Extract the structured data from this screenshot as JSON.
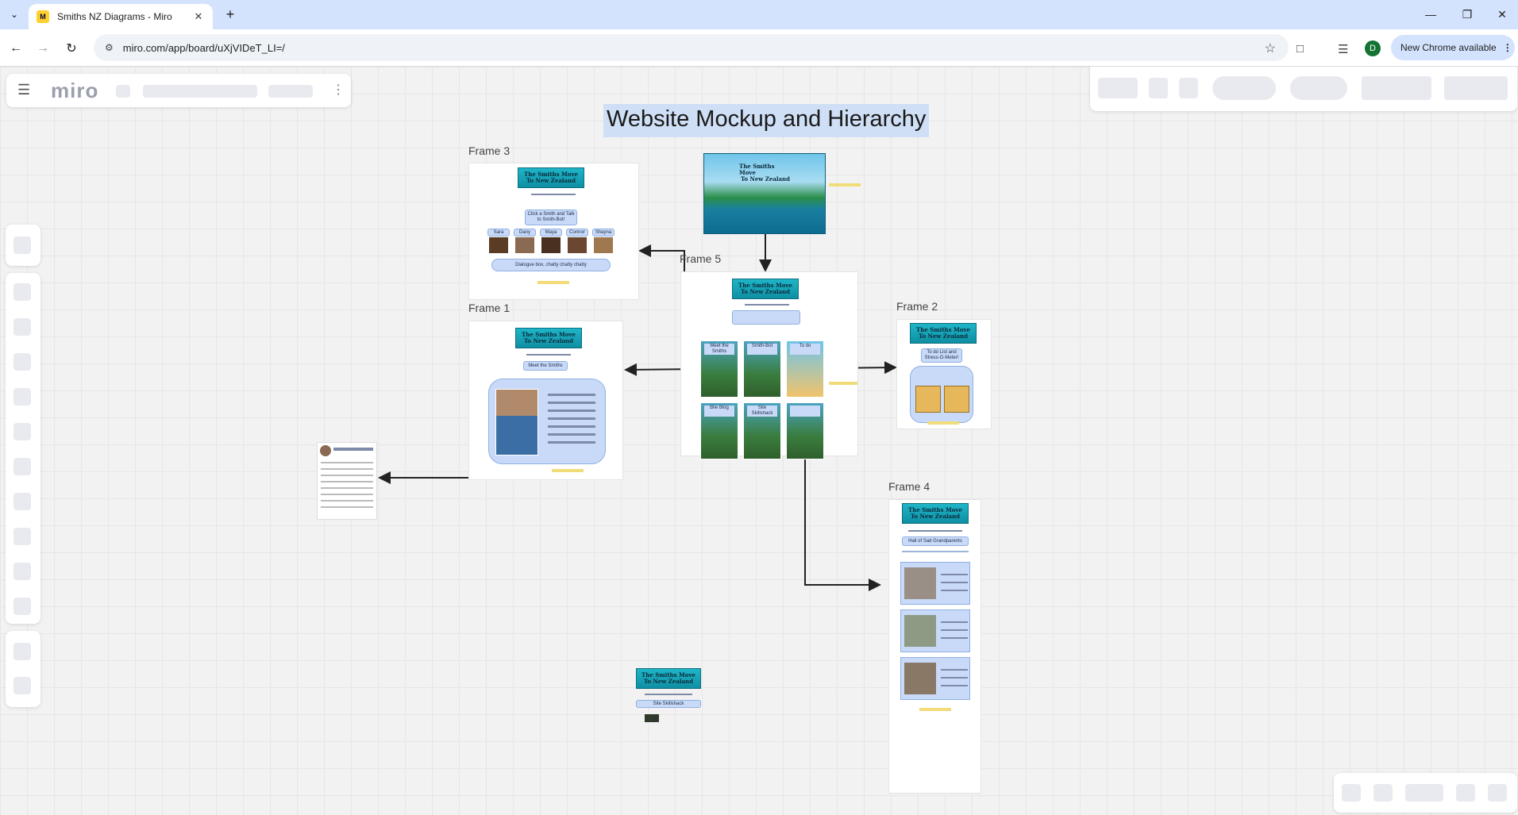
{
  "browser": {
    "tab_title": "Smiths NZ Diagrams - Miro",
    "url": "miro.com/app/board/uXjVIDeT_LI=/",
    "profile_initial": "D",
    "update_label": "New Chrome available"
  },
  "miro": {
    "logo": "miro",
    "board_heading": "Website Mockup and Hierarchy",
    "frames": {
      "frame3": "Frame 3",
      "frame5": "Frame 5",
      "frame1": "Frame 1",
      "frame2": "Frame 2",
      "frame4": "Frame 4"
    },
    "mockup": {
      "banner_line1": "The Smiths Move",
      "banner_line2": "To New Zealand",
      "frame3_prompt": "Click a Smith and Talk to Smith-Bot!",
      "frame3_names": [
        "Sara",
        "Dany",
        "Maya",
        "Connor",
        "Shayna"
      ],
      "frame3_dialogue": "Dialogue box, chatty chatty chatty",
      "frame1_heading": "Meet the Smiths",
      "frame5_tiles": [
        "Meet the Smiths",
        "Smith-Bot",
        "To do",
        "Blie Blog",
        "Site Skillshack",
        ""
      ],
      "frame2_heading": "To do List and Stress-O-Meter!",
      "frame4_heading": "Hall of Sad Grandparents",
      "loose_heading": "Site Skillshack"
    }
  },
  "colors": {
    "tabstrip": "#d3e3fd",
    "canvas": "#f2f2f2",
    "title_highlight": "#cfdff5",
    "banner": "#1fb5c8",
    "mock_box": "#c9daf8"
  }
}
